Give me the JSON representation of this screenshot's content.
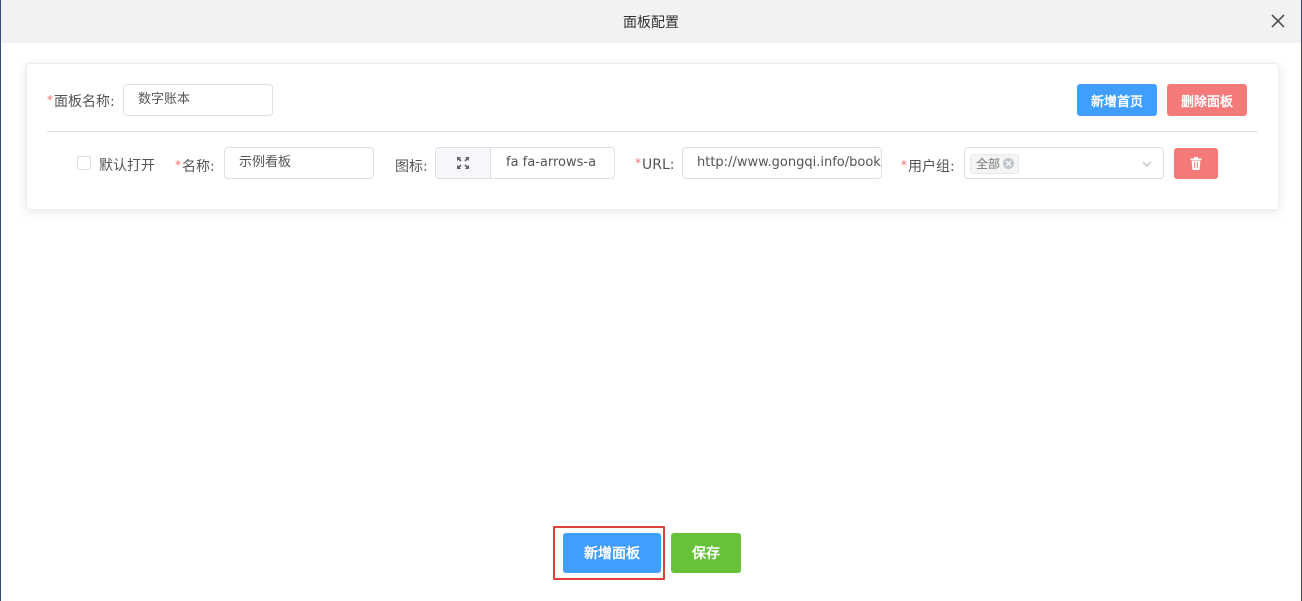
{
  "dialog": {
    "title": "面板配置"
  },
  "panel": {
    "name_label": "面板名称:",
    "name_value": "数字账本",
    "add_home_label": "新增首页",
    "delete_panel_label": "删除面板"
  },
  "row": {
    "default_open_label": "默认打开",
    "default_open_checked": false,
    "name_label": "名称:",
    "name_value": "示例看板",
    "icon_label": "图标:",
    "icon_value": "fa fa-arrows-a",
    "icon_name": "arrows-expand-icon",
    "url_label": "URL:",
    "url_value": "http://www.gongqi.info/book/C",
    "user_group_label": "用户组:",
    "user_group_tag": "全部"
  },
  "footer": {
    "add_panel_label": "新增面板",
    "save_label": "保存"
  },
  "colors": {
    "primary": "#409eff",
    "danger": "#f47a7a",
    "success": "#67c23a",
    "required": "#f56c6c",
    "highlight": "#e0403a"
  }
}
